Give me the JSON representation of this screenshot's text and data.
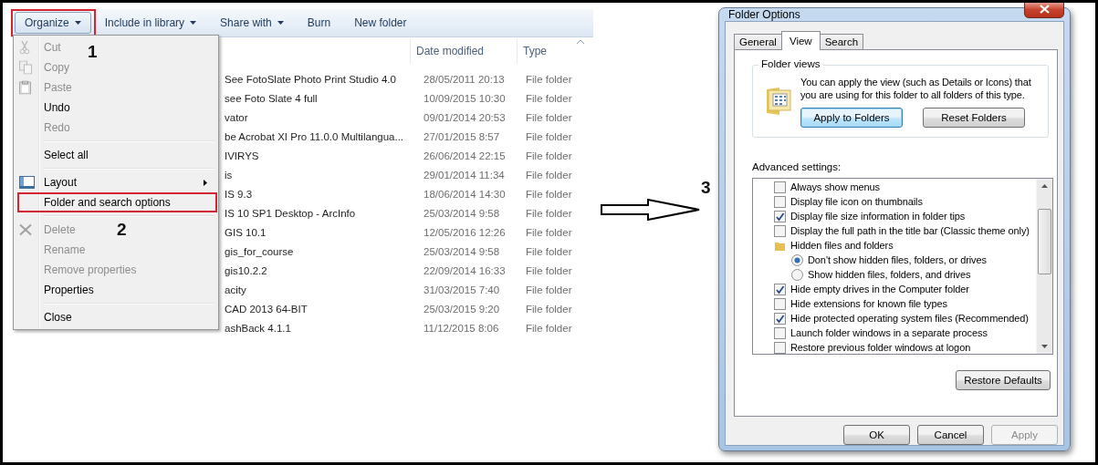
{
  "explorer": {
    "toolbar": [
      {
        "label": "Organize",
        "dropdown": true,
        "step": "1"
      },
      {
        "label": "Include in library",
        "dropdown": true
      },
      {
        "label": "Share with",
        "dropdown": true
      },
      {
        "label": "Burn",
        "dropdown": false
      },
      {
        "label": "New folder",
        "dropdown": false
      }
    ],
    "columns": [
      "Date modified",
      "Type"
    ],
    "rows": [
      {
        "name": "See  FotoSlate Photo Print Studio 4.0",
        "date": "28/05/2011 20:13",
        "type": "File folder"
      },
      {
        "name": "see Foto Slate 4 full",
        "date": "10/09/2015 10:30",
        "type": "File folder"
      },
      {
        "name": "vator",
        "date": "09/01/2014 20:53",
        "type": "File folder"
      },
      {
        "name": "be Acrobat XI Pro 11.0.0 Multilangua...",
        "date": "27/01/2015 8:57",
        "type": "File folder"
      },
      {
        "name": "IVIRYS",
        "date": "26/06/2014 22:15",
        "type": "File folder"
      },
      {
        "name": "is",
        "date": "29/01/2014 11:34",
        "type": "File folder"
      },
      {
        "name": "IS 9.3",
        "date": "18/06/2014 14:30",
        "type": "File folder"
      },
      {
        "name": "IS 10 SP1 Desktop - ArcInfo",
        "date": "25/03/2014 9:58",
        "type": "File folder"
      },
      {
        "name": "GIS 10.1",
        "date": "12/05/2016 12:26",
        "type": "File folder"
      },
      {
        "name": "gis_for_course",
        "date": "25/03/2014 9:58",
        "type": "File folder"
      },
      {
        "name": "gis10.2.2",
        "date": "22/09/2014 16:33",
        "type": "File folder"
      },
      {
        "name": "acity",
        "date": "31/03/2015 7:40",
        "type": "File folder"
      },
      {
        "name": "CAD 2013 64-BIT",
        "date": "25/03/2015 9:20",
        "type": "File folder"
      },
      {
        "name": "ashBack 4.1.1",
        "date": "11/12/2015 8:06",
        "type": "File folder"
      }
    ],
    "menu": [
      {
        "kind": "item",
        "label": "Cut",
        "disabled": true
      },
      {
        "kind": "item",
        "label": "Copy",
        "disabled": true
      },
      {
        "kind": "item",
        "label": "Paste",
        "disabled": true
      },
      {
        "kind": "item",
        "label": "Undo",
        "disabled": false
      },
      {
        "kind": "item",
        "label": "Redo",
        "disabled": true
      },
      {
        "kind": "separator"
      },
      {
        "kind": "item",
        "label": "Select all",
        "disabled": false
      },
      {
        "kind": "separator"
      },
      {
        "kind": "item",
        "label": "Layout",
        "disabled": false,
        "submenu": true
      },
      {
        "kind": "item",
        "label": "Folder and search options",
        "disabled": false,
        "step": "2"
      },
      {
        "kind": "separator"
      },
      {
        "kind": "item",
        "label": "Delete",
        "disabled": true
      },
      {
        "kind": "item",
        "label": "Rename",
        "disabled": true
      },
      {
        "kind": "item",
        "label": "Remove properties",
        "disabled": true
      },
      {
        "kind": "item",
        "label": "Properties",
        "disabled": false
      },
      {
        "kind": "separator"
      },
      {
        "kind": "item",
        "label": "Close",
        "disabled": false
      }
    ]
  },
  "arrow": {
    "step": "3"
  },
  "dialog": {
    "title": "Folder Options",
    "tabs": [
      {
        "label": "General",
        "selected": false
      },
      {
        "label": "View",
        "selected": true
      },
      {
        "label": "Search",
        "selected": false
      }
    ],
    "folder_views": {
      "legend": "Folder views",
      "text": "You can apply the view (such as Details or Icons) that you are using for this folder to all folders of this type.",
      "buttons": [
        {
          "label": "Apply to Folders",
          "default": true
        },
        {
          "label": "Reset Folders",
          "default": false
        }
      ]
    },
    "advanced_label": "Advanced settings:",
    "advanced": [
      {
        "kind": "checkbox",
        "label": "Always show menus",
        "checked": false
      },
      {
        "kind": "checkbox",
        "label": "Display file icon on thumbnails",
        "checked": false
      },
      {
        "kind": "checkbox",
        "label": "Display file size information in folder tips",
        "checked": true
      },
      {
        "kind": "checkbox",
        "label": "Display the full path in the title bar (Classic theme only)",
        "checked": false
      },
      {
        "kind": "folder",
        "label": "Hidden files and folders",
        "children": [
          {
            "kind": "radio",
            "label": "Don't show hidden files, folders, or drives",
            "selected": true
          },
          {
            "kind": "radio",
            "label": "Show hidden files, folders, and drives",
            "selected": false
          }
        ]
      },
      {
        "kind": "checkbox",
        "label": "Hide empty drives in the Computer folder",
        "checked": true
      },
      {
        "kind": "checkbox",
        "label": "Hide extensions for known file types",
        "checked": false
      },
      {
        "kind": "checkbox",
        "label": "Hide protected operating system files (Recommended)",
        "checked": true
      },
      {
        "kind": "checkbox",
        "label": "Launch folder windows in a separate process",
        "checked": false
      },
      {
        "kind": "checkbox",
        "label": "Restore previous folder windows at logon",
        "checked": false
      }
    ],
    "restore_button": "Restore Defaults",
    "buttons": [
      {
        "label": "OK",
        "disabled": false
      },
      {
        "label": "Cancel",
        "disabled": false
      },
      {
        "label": "Apply",
        "disabled": true
      }
    ]
  }
}
